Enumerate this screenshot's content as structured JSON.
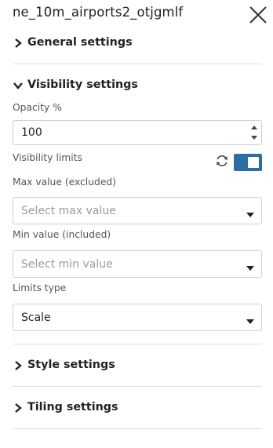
{
  "header": {
    "title": "ne_10m_airports2_otjgmlf",
    "close_icon": "close-icon"
  },
  "sections": {
    "general": {
      "label": "General settings",
      "expanded": false
    },
    "visibility": {
      "label": "Visibility settings",
      "expanded": true
    },
    "style": {
      "label": "Style settings",
      "expanded": false
    },
    "tiling": {
      "label": "Tiling settings",
      "expanded": false
    }
  },
  "visibility": {
    "opacity_label": "Opacity %",
    "opacity_value": "100",
    "limits_label": "Visibility limits",
    "limits_enabled": true,
    "max_label": "Max value (excluded)",
    "max_placeholder": "Select max value",
    "min_label": "Min value (included)",
    "min_placeholder": "Select min value",
    "limits_type_label": "Limits type",
    "limits_type_value": "Scale"
  },
  "colors": {
    "accent": "#2e6da4",
    "divider": "#dcdcdc",
    "placeholder": "#9a9a9a"
  }
}
